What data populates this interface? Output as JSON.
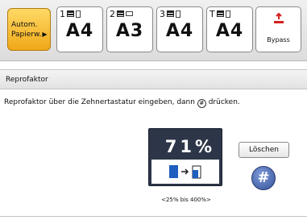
{
  "trays": {
    "auto": {
      "line1": "Autom.",
      "line2": "Papierw.",
      "arrow": "▶"
    },
    "items": [
      {
        "number": "1",
        "size": "A4"
      },
      {
        "number": "2",
        "size": "A3"
      },
      {
        "number": "3",
        "size": "A4"
      },
      {
        "number": "T",
        "size": "A4"
      }
    ],
    "bypass": {
      "label": "Bypass",
      "icon": "bypass-tray-icon"
    }
  },
  "screen": {
    "title": "Reprofaktor",
    "instruction_before": "Reprofaktor über die Zehnertastatur eingeben, dann",
    "instruction_symbol": "#",
    "instruction_after": "drücken."
  },
  "ratio": {
    "value": "71%",
    "range": "<25% bis 400%>",
    "icon": "reduce-document-icon"
  },
  "buttons": {
    "clear": "Löschen",
    "hash": "#"
  },
  "colors": {
    "accent_orange": "#f0a818",
    "display_bg": "#2d3648",
    "hash_blue": "#34529a",
    "bypass_red": "#d42020",
    "doc_blue": "#1f5fbf"
  }
}
